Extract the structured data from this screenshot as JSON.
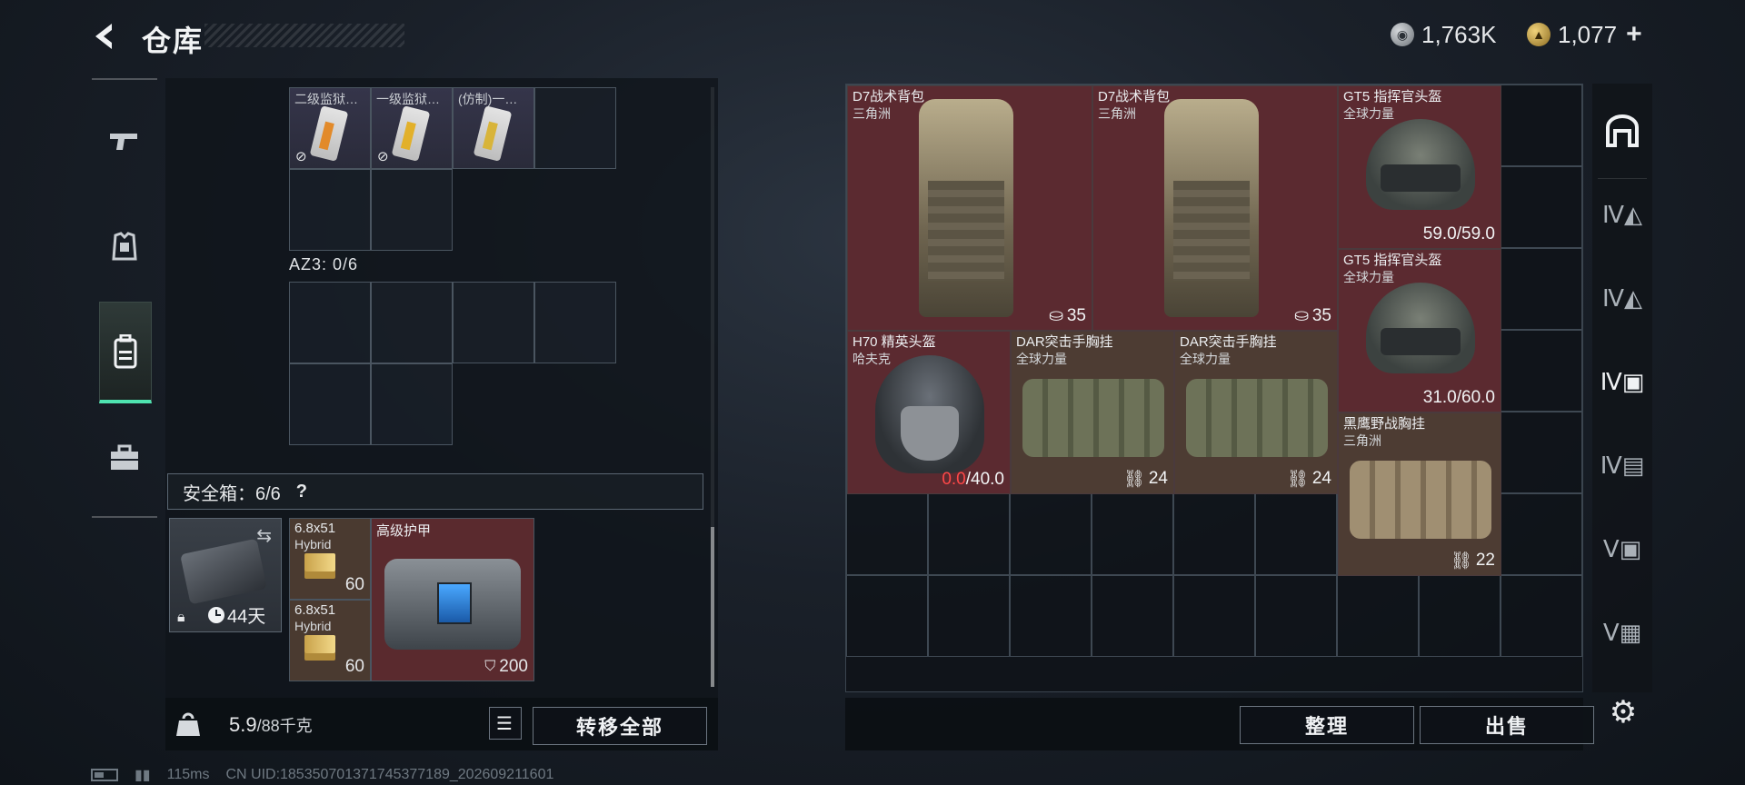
{
  "header": {
    "title": "仓库",
    "currency": [
      {
        "icon": "silver-coin-icon",
        "value": "1,763K"
      },
      {
        "icon": "gold-coin-icon",
        "value": "1,077"
      }
    ],
    "plus_label": "+"
  },
  "left_sidebar": {
    "items": [
      {
        "name": "weapons-tab",
        "icon": "pistol-icon"
      },
      {
        "name": "gear-tab",
        "icon": "armor-icon"
      },
      {
        "name": "backpack-tab",
        "icon": "backpack-icon",
        "active": true
      },
      {
        "name": "toolbox-tab",
        "icon": "toolbox-icon"
      }
    ]
  },
  "container": {
    "top_items": [
      {
        "name": "二级监狱…",
        "no_drop": true
      },
      {
        "name": "一级监狱…",
        "no_drop": true
      },
      {
        "name": "(仿制)一…",
        "no_drop": false
      }
    ],
    "az3_label": "AZ3: 0/6"
  },
  "safe_box": {
    "label": "安全箱：6/6",
    "help": "?",
    "timer": "44天",
    "items": [
      {
        "name": "6.8x51",
        "sub": "Hybrid",
        "count": "60"
      },
      {
        "name": "6.8x51",
        "sub": "Hybrid",
        "count": "60"
      },
      {
        "name": "高级护甲",
        "value": "200"
      }
    ]
  },
  "left_bottom": {
    "weight": "5.9",
    "weight_max": "/88千克",
    "transfer_all": "转移全部"
  },
  "stash": {
    "items": [
      {
        "name": "D7战术背包",
        "sub": "三角洲",
        "value": "35",
        "kind": "backpack"
      },
      {
        "name": "D7战术背包",
        "sub": "三角洲",
        "value": "35",
        "kind": "backpack"
      },
      {
        "name": "GT5 指挥官头盔",
        "sub": "全球力量",
        "value": "59.0/59.0",
        "kind": "helmet"
      },
      {
        "name": "GT5 指挥官头盔",
        "sub": "全球力量",
        "value": "31.0/60.0",
        "kind": "helmet"
      },
      {
        "name": "H70 精英头盔",
        "sub": "哈夫克",
        "value_low": "0.0",
        "value_rest": "/40.0",
        "kind": "helmet-dark"
      },
      {
        "name": "DAR突击手胸挂",
        "sub": "全球力量",
        "value": "24",
        "kind": "vest"
      },
      {
        "name": "DAR突击手胸挂",
        "sub": "全球力量",
        "value": "24",
        "kind": "vest"
      },
      {
        "name": "黑鹰野战胸挂",
        "sub": "三角洲",
        "value": "22",
        "kind": "vest-tan"
      }
    ]
  },
  "right_bottom": {
    "sort_label": "整理",
    "sell_label": "出售"
  },
  "right_sidebar": {
    "tabs": [
      "all-items-icon",
      "tier4-weapon-icon",
      "tier4-gear-icon",
      "tier4-backpack-icon",
      "tier4-case-icon",
      "tier5-box-icon",
      "tier5-crate-icon"
    ]
  },
  "status": {
    "ping": "115ms",
    "uid": "CN UID:1853507013717453771​89_202609211601"
  },
  "colors": {
    "accent": "#4ee3b0",
    "item_red": "#5b2a30",
    "item_brown": "#4d3c33",
    "low_durability": "#ff4848"
  }
}
